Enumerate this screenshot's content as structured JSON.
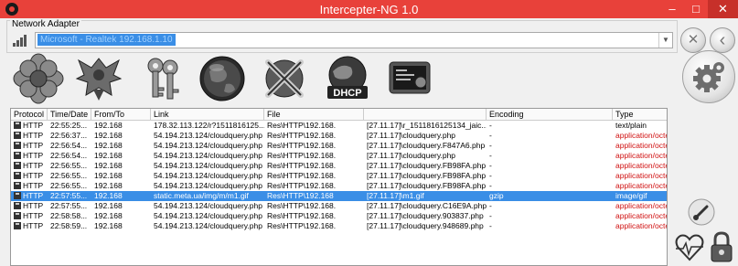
{
  "window": {
    "title": "Intercepter-NG 1.0",
    "minimize_glyph": "–",
    "maximize_glyph": "□",
    "close_glyph": "✕"
  },
  "adapter": {
    "legend": "Network Adapter",
    "selected": "Microsoft - Realtek 192.168.1.10"
  },
  "side_buttons": {
    "close_glyph": "✕",
    "back_glyph": "‹"
  },
  "toolbar": {
    "icons": [
      "flower-icon",
      "eagle-icon",
      "keys-icon",
      "globe-icon",
      "crossed-swords-icon",
      "dhcp-globe-icon",
      "terminal-icon"
    ],
    "dhcp_label": "DHCP"
  },
  "grid": {
    "columns": [
      "Protocol",
      "Time/Date",
      "From/To",
      "Link",
      "File",
      "",
      "Encoding",
      "Type"
    ],
    "rows": [
      {
        "protocol": "HTTP",
        "time": "22:55:25...",
        "from": "192.168",
        "link": "178.32.113.122/r?1511816125...",
        "file": "Res\\HTTP\\192.168.",
        "file2": "[27.11.17]\\r_1511816125134_jaic...",
        "encoding": "-",
        "type": "text/plain",
        "type_red": false,
        "selected": false
      },
      {
        "protocol": "HTTP",
        "time": "22:56:37...",
        "from": "192.168",
        "link": "54.194.213.124/cloudquery.php",
        "file": "Res\\HTTP\\192.168.",
        "file2": "[27.11.17]\\cloudquery.php",
        "encoding": "-",
        "type": "application/octe",
        "type_red": true,
        "selected": false
      },
      {
        "protocol": "HTTP",
        "time": "22:56:54...",
        "from": "192.168",
        "link": "54.194.213.124/cloudquery.php",
        "file": "Res\\HTTP\\192.168.",
        "file2": "[27.11.17]\\cloudquery.F847A6.php",
        "encoding": "-",
        "type": "application/octe",
        "type_red": true,
        "selected": false
      },
      {
        "protocol": "HTTP",
        "time": "22:56:54...",
        "from": "192.168",
        "link": "54.194.213.124/cloudquery.php",
        "file": "Res\\HTTP\\192.168.",
        "file2": "[27.11.17]\\cloudquery.php",
        "encoding": "-",
        "type": "application/octe",
        "type_red": true,
        "selected": false
      },
      {
        "protocol": "HTTP",
        "time": "22:56:55...",
        "from": "192.168",
        "link": "54.194.213.124/cloudquery.php",
        "file": "Res\\HTTP\\192.168.",
        "file2": "[27.11.17]\\cloudquery.FB98FA.php",
        "encoding": "-",
        "type": "application/octe",
        "type_red": true,
        "selected": false
      },
      {
        "protocol": "HTTP",
        "time": "22:56:55...",
        "from": "192.168",
        "link": "54.194.213.124/cloudquery.php",
        "file": "Res\\HTTP\\192.168.",
        "file2": "[27.11.17]\\cloudquery.FB98FA.php",
        "encoding": "-",
        "type": "application/octe",
        "type_red": true,
        "selected": false
      },
      {
        "protocol": "HTTP",
        "time": "22:56:55...",
        "from": "192.168",
        "link": "54.194.213.124/cloudquery.php",
        "file": "Res\\HTTP\\192.168.",
        "file2": "[27.11.17]\\cloudquery.FB98FA.php",
        "encoding": "-",
        "type": "application/octe",
        "type_red": true,
        "selected": false
      },
      {
        "protocol": "HTTP",
        "time": "22:57:55...",
        "from": "192.168",
        "link": "static.meta.ua/img/m/m1.gif",
        "file": "Res\\HTTP\\192.168",
        "file2": "[27.11.17]\\m1.gif",
        "encoding": "gzip",
        "type": "image/gif",
        "type_red": false,
        "selected": true
      },
      {
        "protocol": "HTTP",
        "time": "22:57:55...",
        "from": "192.168",
        "link": "54.194.213.124/cloudquery.php",
        "file": "Res\\HTTP\\192.168.",
        "file2": "[27.11.17]\\cloudquery.C16E9A.php",
        "encoding": "-",
        "type": "application/octe",
        "type_red": true,
        "selected": false
      },
      {
        "protocol": "HTTP",
        "time": "22:58:58...",
        "from": "192.168",
        "link": "54.194.213.124/cloudquery.php",
        "file": "Res\\HTTP\\192.168.",
        "file2": "[27.11.17]\\cloudquery.903837.php",
        "encoding": "-",
        "type": "application/octe",
        "type_red": true,
        "selected": false
      },
      {
        "protocol": "HTTP",
        "time": "22:58:59...",
        "from": "192.168",
        "link": "54.194.213.124/cloudquery.php",
        "file": "Res\\HTTP\\192.168.",
        "file2": "[27.11.17]\\cloudquery.948689.php",
        "encoding": "-",
        "type": "application/octe",
        "type_red": true,
        "selected": false
      }
    ]
  },
  "colors": {
    "titlebar": "#e8413a",
    "selection": "#3a8ee6",
    "octet_text": "#d01010"
  }
}
